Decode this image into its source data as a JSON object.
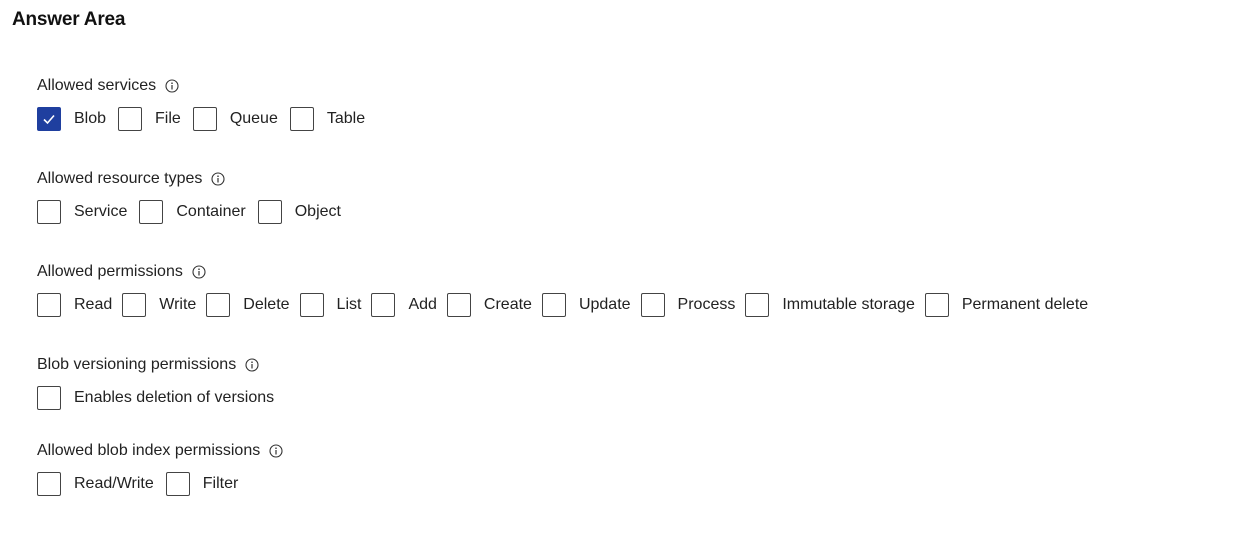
{
  "title": "Answer Area",
  "sections": [
    {
      "id": "services",
      "label": "Allowed services",
      "options": [
        {
          "label": "Blob",
          "checked": true
        },
        {
          "label": "File",
          "checked": false
        },
        {
          "label": "Queue",
          "checked": false
        },
        {
          "label": "Table",
          "checked": false
        }
      ]
    },
    {
      "id": "resource",
      "label": "Allowed resource types",
      "options": [
        {
          "label": "Service",
          "checked": false
        },
        {
          "label": "Container",
          "checked": false
        },
        {
          "label": "Object",
          "checked": false
        }
      ]
    },
    {
      "id": "permissions",
      "label": "Allowed permissions",
      "options": [
        {
          "label": "Read",
          "checked": false
        },
        {
          "label": "Write",
          "checked": false
        },
        {
          "label": "Delete",
          "checked": false
        },
        {
          "label": "List",
          "checked": false
        },
        {
          "label": "Add",
          "checked": false
        },
        {
          "label": "Create",
          "checked": false
        },
        {
          "label": "Update",
          "checked": false
        },
        {
          "label": "Process",
          "checked": false
        },
        {
          "label": "Immutable storage",
          "checked": false
        },
        {
          "label": "Permanent delete",
          "checked": false
        }
      ]
    },
    {
      "id": "versioning",
      "label": "Blob versioning permissions",
      "options": [
        {
          "label": "Enables deletion of versions",
          "checked": false
        }
      ]
    },
    {
      "id": "index",
      "label": "Allowed blob index permissions",
      "options": [
        {
          "label": "Read/Write",
          "checked": false
        },
        {
          "label": "Filter",
          "checked": false
        }
      ]
    }
  ],
  "colors": {
    "checked_fill": "#1f3f9f",
    "checkbox_border": "#444444",
    "text": "#222222"
  },
  "icons": {
    "info": "info-circle-icon",
    "check": "checkmark-icon"
  }
}
